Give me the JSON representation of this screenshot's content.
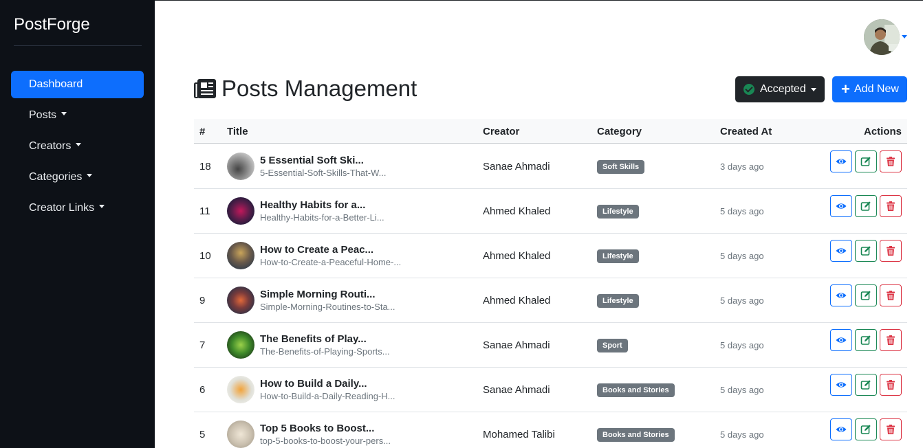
{
  "app": {
    "name": "PostForge"
  },
  "sidebar": {
    "items": [
      {
        "label": "Dashboard",
        "active": true,
        "dropdown": false
      },
      {
        "label": "Posts",
        "active": false,
        "dropdown": true
      },
      {
        "label": "Creators",
        "active": false,
        "dropdown": true
      },
      {
        "label": "Categories",
        "active": false,
        "dropdown": true
      },
      {
        "label": "Creator Links",
        "active": false,
        "dropdown": true
      }
    ]
  },
  "header": {
    "title": "Posts Management",
    "title_icon": "newspaper-icon"
  },
  "toolbar": {
    "status_label": "Accepted",
    "add_label": "Add New"
  },
  "table": {
    "columns": [
      "#",
      "Title",
      "Creator",
      "Category",
      "Created At",
      "Actions"
    ],
    "rows": [
      {
        "id": "18",
        "title": "5 Essential Soft Ski...",
        "slug": "5-Essential-Soft-Skills-That-W...",
        "creator": "Sanae Ahmadi",
        "category": "Soft Skills",
        "created": "3 days ago"
      },
      {
        "id": "11",
        "title": "Healthy Habits for a...",
        "slug": "Healthy-Habits-for-a-Better-Li...",
        "creator": "Ahmed Khaled",
        "category": "Lifestyle",
        "created": "5 days ago"
      },
      {
        "id": "10",
        "title": "How to Create a Peac...",
        "slug": "How-to-Create-a-Peaceful-Home-...",
        "creator": "Ahmed Khaled",
        "category": "Lifestyle",
        "created": "5 days ago"
      },
      {
        "id": "9",
        "title": "Simple Morning Routi...",
        "slug": "Simple-Morning-Routines-to-Sta...",
        "creator": "Ahmed Khaled",
        "category": "Lifestyle",
        "created": "5 days ago"
      },
      {
        "id": "7",
        "title": "The Benefits of Play...",
        "slug": "The-Benefits-of-Playing-Sports...",
        "creator": "Sanae Ahmadi",
        "category": "Sport",
        "created": "5 days ago"
      },
      {
        "id": "6",
        "title": "How to Build a Daily...",
        "slug": "How-to-Build-a-Daily-Reading-H...",
        "creator": "Sanae Ahmadi",
        "category": "Books and Stories",
        "created": "5 days ago"
      },
      {
        "id": "5",
        "title": "Top 5 Books to Boost...",
        "slug": "top-5-books-to-boost-your-pers...",
        "creator": "Mohamed Talibi",
        "category": "Books and Stories",
        "created": "5 days ago"
      }
    ]
  },
  "colors": {
    "sidebar_bg": "#0d1117",
    "accent": "#0d6efd",
    "success": "#198754",
    "danger": "#dc3545",
    "badge": "#6c757d"
  }
}
